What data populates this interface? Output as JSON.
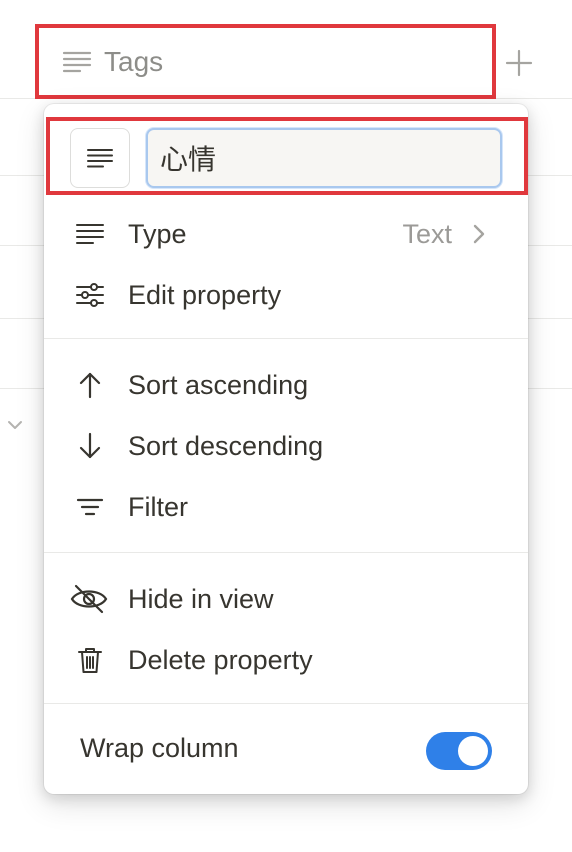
{
  "column_header": {
    "label": "Tags",
    "icon": "text-lines-icon",
    "add_icon": "plus-icon"
  },
  "property_menu": {
    "name_input": {
      "value": "心情",
      "icon": "text-lines-icon"
    },
    "type": {
      "label": "Type",
      "value": "Text",
      "icon": "text-lines-icon"
    },
    "edit_property": {
      "label": "Edit property",
      "icon": "sliders-icon"
    },
    "sort_ascending": {
      "label": "Sort ascending",
      "icon": "arrow-up-icon"
    },
    "sort_descending": {
      "label": "Sort descending",
      "icon": "arrow-down-icon"
    },
    "filter": {
      "label": "Filter",
      "icon": "filter-icon"
    },
    "hide_in_view": {
      "label": "Hide in view",
      "icon": "eye-slash-icon"
    },
    "delete_property": {
      "label": "Delete property",
      "icon": "trash-icon"
    },
    "wrap_column": {
      "label": "Wrap column",
      "enabled": true
    }
  },
  "colors": {
    "highlight_border": "#e0383d",
    "toggle_on": "#2f80e8",
    "input_focus_border": "#a9c8ee"
  }
}
